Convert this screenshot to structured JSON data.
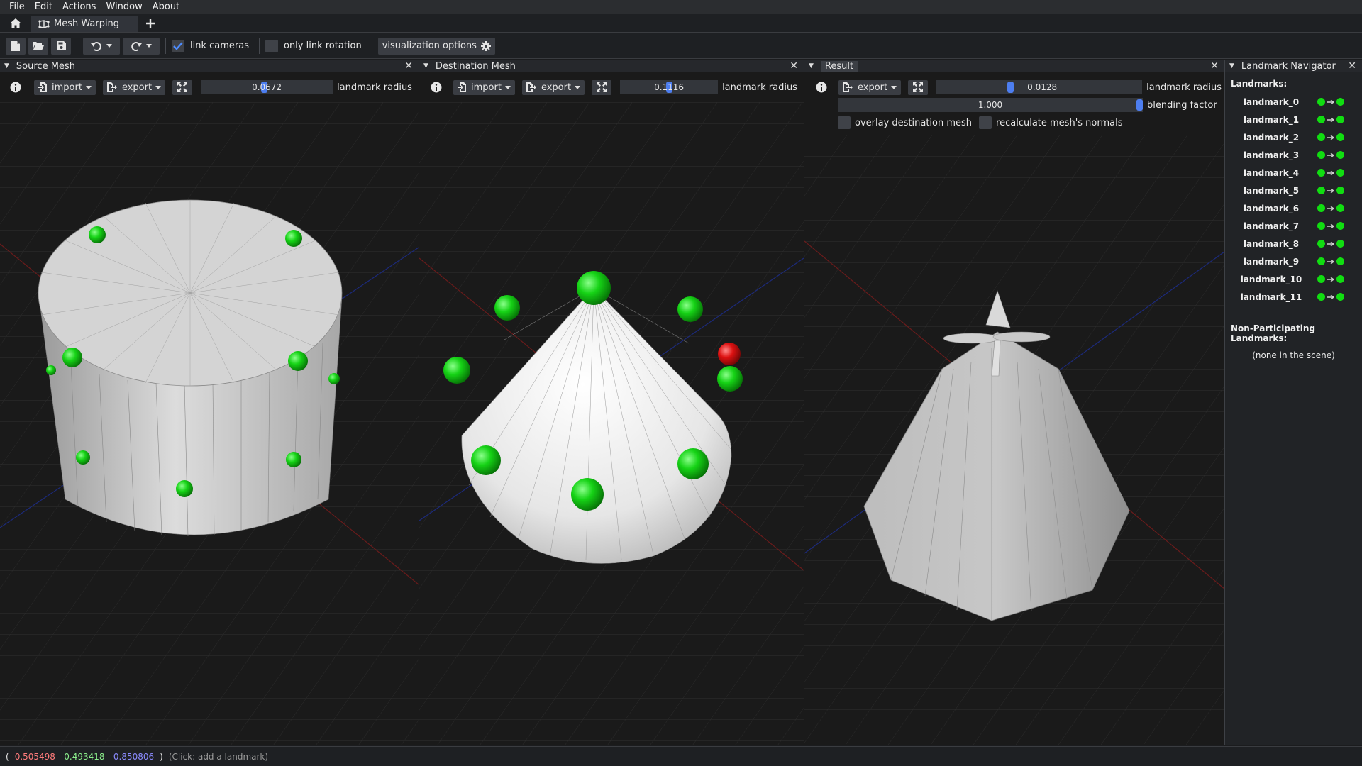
{
  "menu": [
    "File",
    "Edit",
    "Actions",
    "Window",
    "About"
  ],
  "tabs": {
    "active_label": "Mesh Warping"
  },
  "toolbar": {
    "link_cameras_label": "link cameras",
    "link_cameras_checked": true,
    "only_link_rotation_label": "only link rotation",
    "only_link_rotation_checked": false,
    "visualization_options_label": "visualization options"
  },
  "source_panel": {
    "title": "Source Mesh",
    "import_label": "import",
    "export_label": "export",
    "landmark_radius_value": "0.0672",
    "landmark_radius_fraction": 0.48,
    "landmark_radius_label": "landmark radius"
  },
  "destination_panel": {
    "title": "Destination Mesh",
    "import_label": "import",
    "export_label": "export",
    "landmark_radius_value": "0.1116",
    "landmark_radius_fraction": 0.5,
    "landmark_radius_label": "landmark radius"
  },
  "result_panel": {
    "title": "Result",
    "export_label": "export",
    "landmark_radius_value": "0.0128",
    "landmark_radius_fraction": 0.36,
    "landmark_radius_label": "landmark radius",
    "blending_factor_value": "1.000",
    "blending_factor_fraction": 1.0,
    "blending_factor_label": "blending factor",
    "overlay_label": "overlay destination mesh",
    "recalc_label": "recalculate mesh's normals"
  },
  "navigator": {
    "title": "Landmark Navigator",
    "landmarks_header": "Landmarks:",
    "landmarks": [
      "landmark_0",
      "landmark_1",
      "landmark_2",
      "landmark_3",
      "landmark_4",
      "landmark_5",
      "landmark_6",
      "landmark_7",
      "landmark_8",
      "landmark_9",
      "landmark_10",
      "landmark_11"
    ],
    "non_participating_header": "Non-Participating Landmarks:",
    "non_participating_text": "(none in the scene)"
  },
  "status": {
    "open_paren": "(",
    "x": "0.505498",
    "y": "-0.493418",
    "z": "-0.850806",
    "close_paren": ")",
    "hint": "(Click: add a landmark)"
  },
  "colors": {
    "landmark_green": "#11dd11",
    "selected_red": "#dd1111",
    "slider_blue": "#4d7ef0",
    "x_red": "#ff7b7b",
    "y_green": "#8cf08c",
    "z_blue": "#8b8bff"
  }
}
